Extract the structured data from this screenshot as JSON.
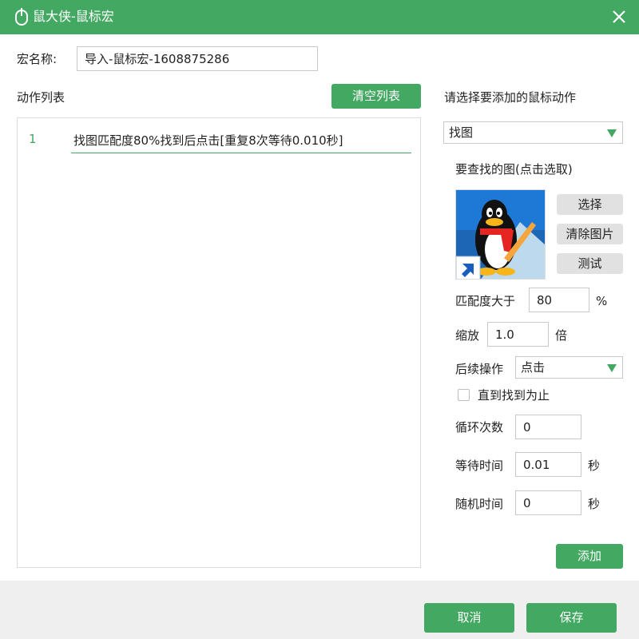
{
  "window": {
    "title": "鼠大侠-鼠标宏"
  },
  "macro_name": {
    "label": "宏名称:",
    "value": "导入-鼠标宏-1608875286"
  },
  "action_list": {
    "label": "动作列表",
    "clear_label": "清空列表",
    "items": [
      {
        "index": "1",
        "text": "找图匹配度80%找到后点击[重复8次等待0.010秒]"
      }
    ]
  },
  "add_panel": {
    "title": "请选择要添加的鼠标动作",
    "action_type": "找图",
    "image_label": "要查找的图(点击选取)",
    "select_label": "选择",
    "clear_image_label": "清除图片",
    "test_label": "测试",
    "match_label": "匹配度大于",
    "match_value": "80",
    "match_unit": "%",
    "scale_label": "缩放",
    "scale_value": "1.0",
    "scale_unit": "倍",
    "followup_label": "后续操作",
    "followup_value": "点击",
    "until_found_label": "直到找到为止",
    "until_found_checked": false,
    "loop_label": "循环次数",
    "loop_value": "0",
    "wait_label": "等待时间",
    "wait_value": "0.01",
    "wait_unit": "秒",
    "random_label": "随机时间",
    "random_value": "0",
    "random_unit": "秒",
    "add_label": "添加"
  },
  "footer": {
    "cancel_label": "取消",
    "save_label": "保存"
  },
  "colors": {
    "accent": "#43a862",
    "footer_bg": "#efefef",
    "gray_button": "#e1e1e1"
  }
}
